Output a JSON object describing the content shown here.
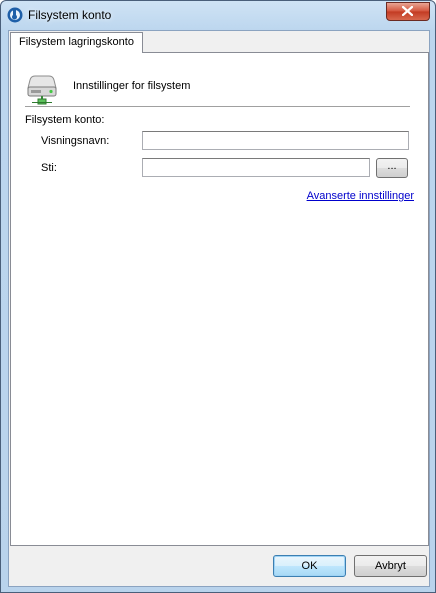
{
  "window": {
    "title": "Filsystem konto",
    "app_icon": "app-logo-icon",
    "close_icon": "close-icon"
  },
  "tab": {
    "label": "Filsystem lagringskonto"
  },
  "header": {
    "icon": "hard-drive-icon",
    "title": "Innstillinger for filsystem"
  },
  "form": {
    "group_label": "Filsystem konto:",
    "display_name": {
      "label": "Visningsnavn:",
      "value": ""
    },
    "path": {
      "label": "Sti:",
      "value": "",
      "browse_label": "..."
    },
    "advanced_link": "Avanserte innstillinger"
  },
  "footer": {
    "ok_label": "OK",
    "cancel_label": "Avbryt"
  },
  "colors": {
    "link": "#0000cc",
    "title_bar": "#bcd6ee",
    "close_button": "#c23a22"
  }
}
